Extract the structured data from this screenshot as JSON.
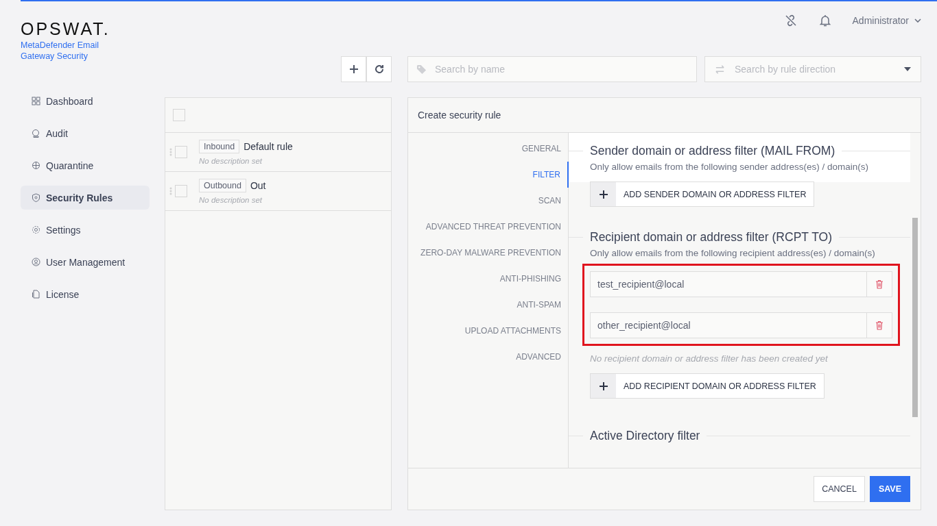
{
  "brand": {
    "logo": "OPSWAT.",
    "product": "MetaDefender Email Gateway Security"
  },
  "topbar": {
    "user": "Administrator"
  },
  "sidebar": {
    "items": [
      {
        "label": "Dashboard",
        "selected": false
      },
      {
        "label": "Audit",
        "selected": false
      },
      {
        "label": "Quarantine",
        "selected": false
      },
      {
        "label": "Security Rules",
        "selected": true
      },
      {
        "label": "Settings",
        "selected": false
      },
      {
        "label": "User Management",
        "selected": false
      },
      {
        "label": "License",
        "selected": false
      }
    ]
  },
  "toolbar": {
    "search_placeholder": "Search by name",
    "direction_placeholder": "Search by rule direction"
  },
  "rules": {
    "select_all_checked": false,
    "items": [
      {
        "direction": "Inbound",
        "name": "Default rule",
        "description": "No description set",
        "checked": false
      },
      {
        "direction": "Outbound",
        "name": "Out",
        "description": "No description set",
        "checked": false
      }
    ]
  },
  "form": {
    "title": "Create security rule",
    "tabs": [
      {
        "label": "GENERAL",
        "selected": false
      },
      {
        "label": "FILTER",
        "selected": true
      },
      {
        "label": "SCAN",
        "selected": false
      },
      {
        "label": "ADVANCED THREAT PREVENTION",
        "selected": false
      },
      {
        "label": "ZERO-DAY MALWARE PREVENTION",
        "selected": false
      },
      {
        "label": "ANTI-PHISHING",
        "selected": false
      },
      {
        "label": "ANTI-SPAM",
        "selected": false
      },
      {
        "label": "UPLOAD ATTACHMENTS",
        "selected": false
      },
      {
        "label": "ADVANCED",
        "selected": false
      }
    ],
    "sections": [
      {
        "title": "Sender domain or address filter (MAIL FROM)",
        "description": "Only allow emails from the following sender address(es) / domain(s)",
        "add_button": "ADD SENDER DOMAIN OR ADDRESS FILTER"
      },
      {
        "title": "Recipient domain or address filter (RCPT TO)",
        "description": "Only allow emails from the following recipient address(es) / domain(s)",
        "entries": [
          "test_recipient@local",
          "other_recipient@local"
        ],
        "empty_note": "No recipient domain or address filter has been created yet",
        "add_button": "ADD RECIPIENT DOMAIN OR ADDRESS FILTER",
        "highlighted": true
      },
      {
        "title": "Active Directory filter"
      }
    ],
    "buttons": [
      {
        "label": "CANCEL",
        "kind": "secondary"
      },
      {
        "label": "SAVE",
        "kind": "primary"
      }
    ]
  }
}
